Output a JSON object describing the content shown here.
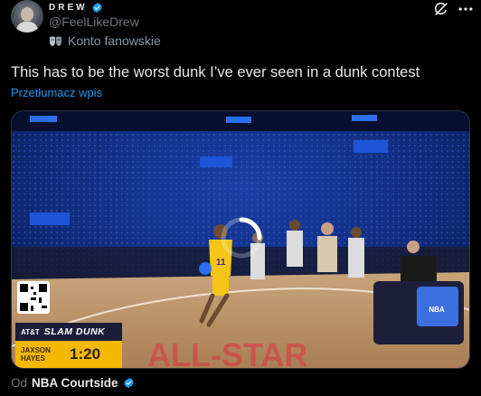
{
  "author": {
    "display_name": "DREW",
    "handle": "@FeelLikeDrew",
    "affiliation_label": "Konto fanowskie",
    "verified_icon": "verified-badge-icon",
    "avatar_icon": "avatar"
  },
  "actions": {
    "grok_icon": "grok-icon",
    "more_icon": "more-icon"
  },
  "tweet": {
    "text": "This has to be the worst dunk I’ve ever seen in a dunk contest",
    "translate_label": "Przetłumacz wpis"
  },
  "media": {
    "scoreboard": {
      "sponsor": "AT&T",
      "event": "SLAM DUNK",
      "player_first": "JAXSON",
      "player_last": "HAYES",
      "clock": "1:20"
    },
    "jersey_number": "11",
    "loading_icon": "loading-spinner-icon"
  },
  "source": {
    "prefix": "Od",
    "name": "NBA Courtside"
  },
  "colors": {
    "background": "#000000",
    "text": "#e7e9ea",
    "muted": "#71767b",
    "link": "#1d9bf0",
    "verified": "#1d9bf0",
    "scoreboard_gold": "#f5b800"
  }
}
